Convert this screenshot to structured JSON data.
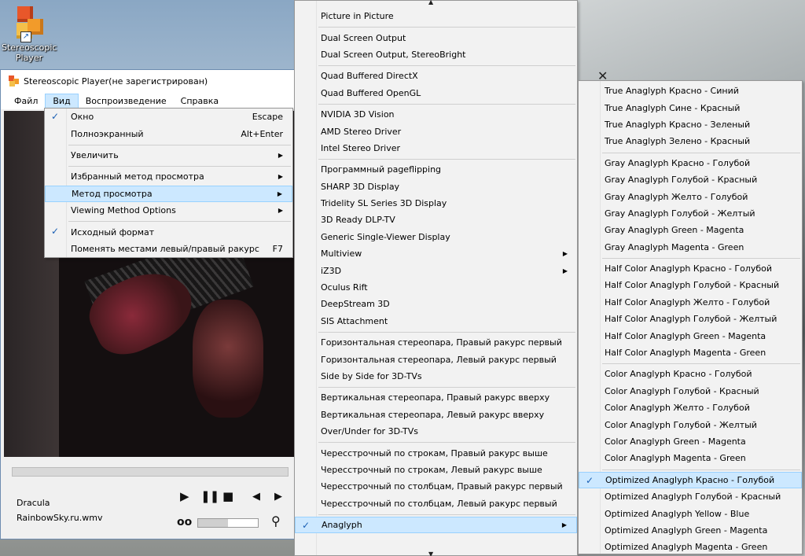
{
  "desktop_icon": {
    "label": "Stereoscopic Player"
  },
  "player": {
    "title": "Stereoscopic Player(не зарегистрирован)",
    "menubar": [
      "Файл",
      "Вид",
      "Воспроизведение",
      "Справка"
    ],
    "media_title": "Dracula",
    "media_file": "RainbowSky.ru.wmv",
    "volume_fraction": 0.5
  },
  "close_glyph": "✕",
  "view_menu": [
    {
      "label": "Окно",
      "accel": "Escape",
      "checked": true
    },
    {
      "label": "Полноэкранный",
      "accel": "Alt+Enter"
    },
    {
      "sep": true
    },
    {
      "label": "Увеличить",
      "submenu": true
    },
    {
      "sep": true
    },
    {
      "label": "Избранный метод просмотра",
      "submenu": true
    },
    {
      "label": "Метод просмотра",
      "submenu": true,
      "highlight": true
    },
    {
      "label": "Viewing Method Options",
      "submenu": true
    },
    {
      "sep": true
    },
    {
      "label": "Исходный формат",
      "checked": true
    },
    {
      "label": "Поменять местами левый/правый ракурс",
      "accel": "F7"
    }
  ],
  "method_menu": [
    {
      "label": "Picture in Picture"
    },
    {
      "sep": true
    },
    {
      "label": "Dual Screen Output"
    },
    {
      "label": "Dual Screen Output, StereoBright"
    },
    {
      "sep": true
    },
    {
      "label": "Quad Buffered DirectX"
    },
    {
      "label": "Quad Buffered OpenGL"
    },
    {
      "sep": true
    },
    {
      "label": "NVIDIA 3D Vision"
    },
    {
      "label": "AMD Stereo Driver"
    },
    {
      "label": "Intel Stereo Driver"
    },
    {
      "sep": true
    },
    {
      "label": "Программный pageflipping"
    },
    {
      "label": "SHARP 3D Display"
    },
    {
      "label": "Tridelity SL Series 3D Display"
    },
    {
      "label": "3D Ready DLP-TV"
    },
    {
      "label": "Generic Single-Viewer Display"
    },
    {
      "label": "Multiview",
      "submenu": true
    },
    {
      "label": "iZ3D",
      "submenu": true
    },
    {
      "label": "Oculus Rift"
    },
    {
      "label": "DeepStream 3D"
    },
    {
      "label": "SIS Attachment"
    },
    {
      "sep": true
    },
    {
      "label": "Горизонтальная стереопара, Правый ракурс первый"
    },
    {
      "label": "Горизонтальная стереопара, Левый ракурс первый"
    },
    {
      "label": "Side by Side for 3D-TVs"
    },
    {
      "sep": true
    },
    {
      "label": "Вертикальная стереопара, Правый ракурс вверху"
    },
    {
      "label": "Вертикальная стереопара, Левый ракурс вверху"
    },
    {
      "label": "Over/Under for 3D-TVs"
    },
    {
      "sep": true
    },
    {
      "label": "Чересстрочный по строкам, Правый ракурс выше"
    },
    {
      "label": "Чересстрочный по строкам, Левый ракурс выше"
    },
    {
      "label": "Чересстрочный по столбцам, Правый ракурс первый"
    },
    {
      "label": "Чересстрочный по столбцам, Левый ракурс первый"
    },
    {
      "sep": true
    },
    {
      "label": "Anaglyph",
      "submenu": true,
      "checked": true,
      "highlight": true
    }
  ],
  "anaglyph_menu": [
    {
      "label": "True Anaglyph Красно - Синий"
    },
    {
      "label": "True Anaglyph Сине - Красный"
    },
    {
      "label": "True Anaglyph Красно - Зеленый"
    },
    {
      "label": "True Anaglyph Зелено - Красный"
    },
    {
      "sep": true
    },
    {
      "label": "Gray Anaglyph Красно - Голубой"
    },
    {
      "label": "Gray Anaglyph Голубой - Красный"
    },
    {
      "label": "Gray Anaglyph Желто - Голубой"
    },
    {
      "label": "Gray Anaglyph Голубой - Желтый"
    },
    {
      "label": "Gray Anaglyph Green - Magenta"
    },
    {
      "label": "Gray Anaglyph Magenta - Green"
    },
    {
      "sep": true
    },
    {
      "label": "Half Color Anaglyph Красно - Голубой"
    },
    {
      "label": "Half Color Anaglyph Голубой - Красный"
    },
    {
      "label": "Half Color Anaglyph Желто - Голубой"
    },
    {
      "label": "Half Color Anaglyph Голубой - Желтый"
    },
    {
      "label": "Half Color Anaglyph Green - Magenta"
    },
    {
      "label": "Half Color Anaglyph Magenta - Green"
    },
    {
      "sep": true
    },
    {
      "label": "Color Anaglyph Красно - Голубой"
    },
    {
      "label": "Color Anaglyph Голубой - Красный"
    },
    {
      "label": "Color Anaglyph Желто - Голубой"
    },
    {
      "label": "Color Anaglyph Голубой - Желтый"
    },
    {
      "label": "Color Anaglyph Green - Magenta"
    },
    {
      "label": "Color Anaglyph Magenta - Green"
    },
    {
      "sep": true
    },
    {
      "label": "Optimized Anaglyph Красно - Голубой",
      "checked": true,
      "highlight": true
    },
    {
      "label": "Optimized Anaglyph Голубой - Красный"
    },
    {
      "label": "Optimized Anaglyph Yellow - Blue"
    },
    {
      "label": "Optimized Anaglyph Green - Magenta"
    },
    {
      "label": "Optimized Anaglyph Magenta - Green"
    }
  ]
}
